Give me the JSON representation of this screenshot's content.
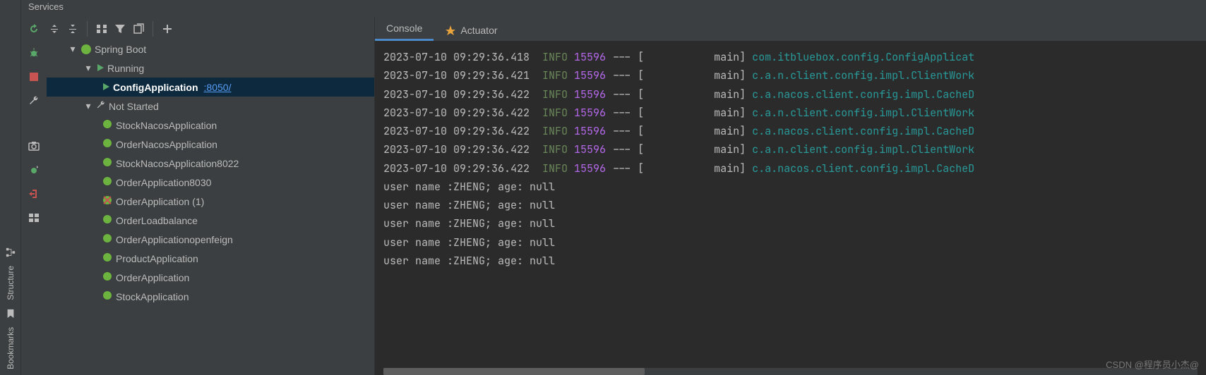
{
  "panel_title": "Services",
  "left_rail": {
    "structure": "Structure",
    "bookmarks": "Bookmarks"
  },
  "tree": {
    "root_label": "Spring Boot",
    "running_label": "Running",
    "running_item": {
      "name": "ConfigApplication",
      "port": ":8050/"
    },
    "not_started_label": "Not Started",
    "not_started_items": [
      "StockNacosApplication",
      "OrderNacosApplication",
      "StockNacosApplication8022",
      "OrderApplication8030",
      "OrderApplication (1)",
      "OrderLoadbalance",
      "OrderApplicationopenfeign",
      "ProductApplication",
      "OrderApplication",
      "StockApplication"
    ]
  },
  "tabs": {
    "console": "Console",
    "actuator": "Actuator"
  },
  "log_lines": [
    {
      "ts": "2023-07-10 09:29:36.418",
      "level": "INFO",
      "pid": "15596",
      "thread": "main",
      "cls": "com.itbluebox.config.ConfigApplicat"
    },
    {
      "ts": "2023-07-10 09:29:36.421",
      "level": "INFO",
      "pid": "15596",
      "thread": "main",
      "cls": "c.a.n.client.config.impl.ClientWork"
    },
    {
      "ts": "2023-07-10 09:29:36.422",
      "level": "INFO",
      "pid": "15596",
      "thread": "main",
      "cls": "c.a.nacos.client.config.impl.CacheD"
    },
    {
      "ts": "2023-07-10 09:29:36.422",
      "level": "INFO",
      "pid": "15596",
      "thread": "main",
      "cls": "c.a.n.client.config.impl.ClientWork"
    },
    {
      "ts": "2023-07-10 09:29:36.422",
      "level": "INFO",
      "pid": "15596",
      "thread": "main",
      "cls": "c.a.nacos.client.config.impl.CacheD"
    },
    {
      "ts": "2023-07-10 09:29:36.422",
      "level": "INFO",
      "pid": "15596",
      "thread": "main",
      "cls": "c.a.n.client.config.impl.ClientWork"
    },
    {
      "ts": "2023-07-10 09:29:36.422",
      "level": "INFO",
      "pid": "15596",
      "thread": "main",
      "cls": "c.a.nacos.client.config.impl.CacheD"
    }
  ],
  "plain_lines": [
    "user name :ZHENG; age: null",
    "user name :ZHENG; age: null",
    "user name :ZHENG; age: null",
    "user name :ZHENG; age: null",
    "user name :ZHENG; age: null"
  ],
  "watermark": "CSDN @程序员小杰@"
}
